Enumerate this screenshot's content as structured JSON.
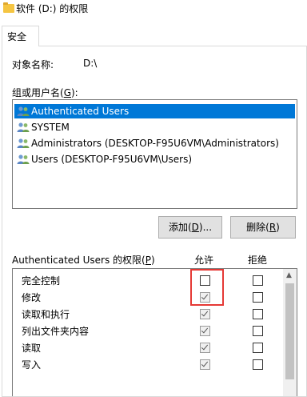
{
  "window": {
    "title": "软件 (D:) 的权限"
  },
  "tabs": [
    {
      "label": "安全"
    }
  ],
  "object": {
    "label": "对象名称:",
    "value": "D:\\"
  },
  "groups": {
    "label": "组或用户名(G):",
    "items": [
      {
        "label": "Authenticated Users",
        "selected": true
      },
      {
        "label": "SYSTEM"
      },
      {
        "label": "Administrators (DESKTOP-F95U6VM\\Administrators)"
      },
      {
        "label": "Users (DESKTOP-F95U6VM\\Users)"
      }
    ]
  },
  "buttons": {
    "add": "添加(D)...",
    "remove": "删除(R)"
  },
  "permissions": {
    "header": "Authenticated Users 的权限(P)",
    "allow_label": "允许",
    "deny_label": "拒绝",
    "rows": [
      {
        "name": "完全控制",
        "allow": false,
        "deny": false
      },
      {
        "name": "修改",
        "allow": true,
        "deny": false
      },
      {
        "name": "读取和执行",
        "allow": true,
        "deny": false
      },
      {
        "name": "列出文件夹内容",
        "allow": true,
        "deny": false
      },
      {
        "name": "读取",
        "allow": true,
        "deny": false
      },
      {
        "name": "写入",
        "allow": true,
        "deny": false
      }
    ]
  },
  "colors": {
    "selection": "#0078d7",
    "highlight_frame": "#e53935"
  }
}
